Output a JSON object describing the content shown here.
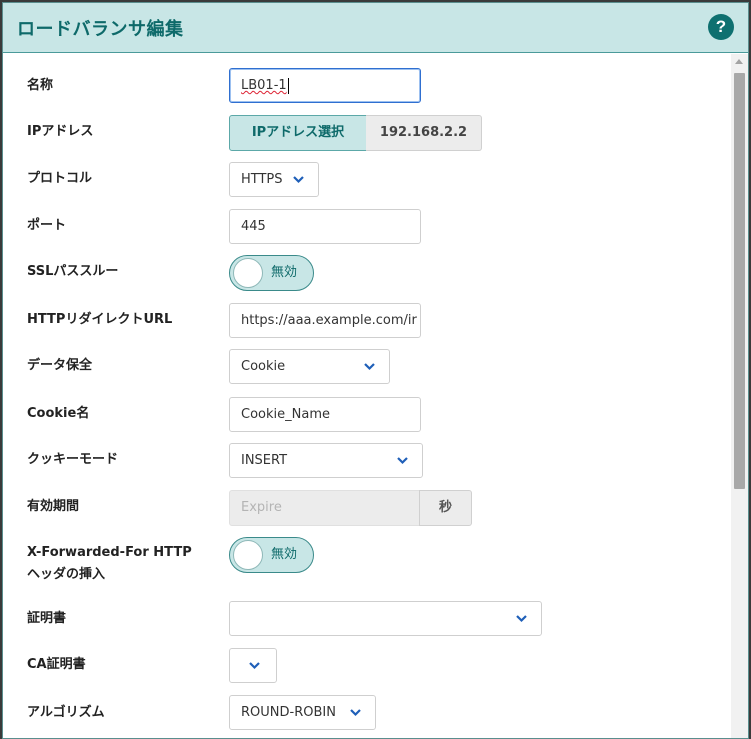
{
  "dialog": {
    "title": "ロードバランサ編集",
    "help_label": "?"
  },
  "colors": {
    "accent": "#0e7070",
    "header_bg": "#c8e6e6",
    "focus_border": "#2f6fd0"
  },
  "form": {
    "name": {
      "label": "名称",
      "value": "LB01-1"
    },
    "ip": {
      "label": "IPアドレス",
      "select_button": "IPアドレス選択",
      "value": "192.168.2.2"
    },
    "protocol": {
      "label": "プロトコル",
      "value": "HTTPS"
    },
    "port": {
      "label": "ポート",
      "value": "445"
    },
    "ssl_passthrough": {
      "label": "SSLパススルー",
      "state": "無効"
    },
    "http_redirect": {
      "label": "HTTPリダイレクトURL",
      "value": "https://aaa.example.com/ir"
    },
    "persistence": {
      "label": "データ保全",
      "value": "Cookie"
    },
    "cookie_name": {
      "label": "Cookie名",
      "value": "Cookie_Name"
    },
    "cookie_mode": {
      "label": "クッキーモード",
      "value": "INSERT"
    },
    "expire": {
      "label": "有効期間",
      "placeholder": "Expire",
      "unit": "秒"
    },
    "xff": {
      "label_line1": "X-Forwarded-For HTTP",
      "label_line2": "ヘッダの挿入",
      "state": "無効"
    },
    "certificate": {
      "label": "証明書",
      "value": ""
    },
    "ca_certificate": {
      "label": "CA証明書",
      "value": ""
    },
    "algorithm": {
      "label": "アルゴリズム",
      "value": "ROUND-ROBIN"
    }
  },
  "icons": {
    "help": "question-circle-icon",
    "dropdown": "chevron-down-icon"
  }
}
